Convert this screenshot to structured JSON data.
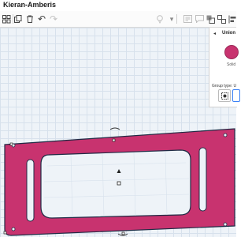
{
  "app": {
    "title": "Kieran-Amberis"
  },
  "toolbar": {
    "icons": [
      "grid-icon",
      "copy-icon",
      "delete-icon",
      "undo-icon",
      "redo-icon",
      "bulb-icon",
      "note-icon",
      "comment-icon",
      "group-icon",
      "ungroup-icon",
      "align-icon",
      "mirror-icon"
    ]
  },
  "panel": {
    "title": "Union",
    "color_label": "Solid",
    "color": "#c8336f",
    "group_type_label": "Group type: U"
  },
  "shape": {
    "color": "#c8336f",
    "outline": "#1f2a44"
  }
}
